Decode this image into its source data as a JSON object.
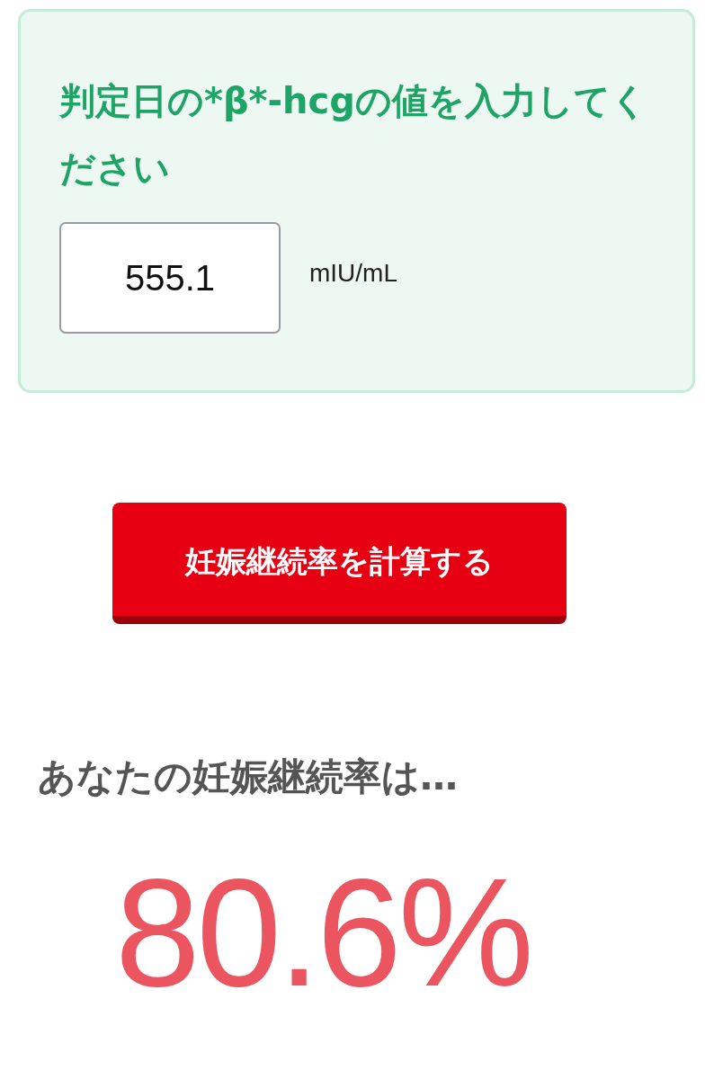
{
  "input_card": {
    "title": "判定日の*β*-hcgの値を入力してください",
    "value": "555.1",
    "unit": "mIU/mL"
  },
  "calculate_button": {
    "label": "妊娠継続率を計算する"
  },
  "result": {
    "heading": "あなたの妊娠継続率は…",
    "value": "80.6%"
  }
}
